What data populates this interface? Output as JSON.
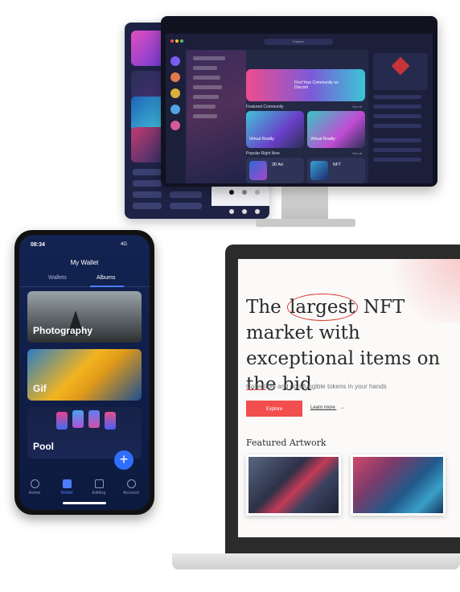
{
  "monitor": {
    "search_label": "Explore",
    "banner_text": "Find Your Community on Discord",
    "featured_heading": "Featured Community",
    "popular_heading": "Popular Right Now",
    "see_all": "See all",
    "cards": [
      {
        "title": "Virtual Reality"
      },
      {
        "title": "Virtual Reality"
      },
      {
        "title": "3D Art"
      },
      {
        "title": "NFT"
      }
    ]
  },
  "phone": {
    "time": "08:34",
    "signal": "4G",
    "title": "My Wallet",
    "tabs": [
      "Wallets",
      "Albums"
    ],
    "albums": [
      {
        "label": "Photography"
      },
      {
        "label": "Gif"
      },
      {
        "label": "Pool"
      }
    ],
    "add_label": "+",
    "nav": [
      "Home",
      "Wallet",
      "Editing",
      "Account"
    ]
  },
  "laptop": {
    "headline_pre": "The",
    "headline_circled": "largest",
    "headline_post": "NFT market with exceptional items on the bid",
    "subtitle_underlined": "Collect",
    "subtitle_rest": "ible and non-fungible tokens in your hands",
    "explore_label": "Explore",
    "learn_label": "Learn more",
    "arrow": "→",
    "featured_heading": "Featured Artwork"
  },
  "colors": {
    "accent_red": "#f24e4e",
    "phone_bg": "#132352",
    "fab_blue": "#2f6fff"
  }
}
